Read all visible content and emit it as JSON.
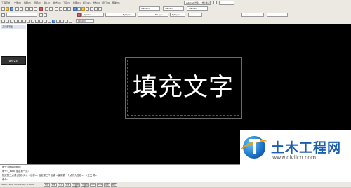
{
  "menu": {
    "title_text": "工程控制",
    "items": [
      "文件(F)",
      "编辑(E)",
      "视图(V)",
      "插入(I)",
      "格式(O)",
      "工具(T)",
      "绘图(D)",
      "标注(N)",
      "修改(M)",
      "窗口(W)",
      "帮助(H)"
    ]
  },
  "toolbar": {
    "workspace": "AutoCAD 经典 - 二维绘图与注释",
    "layer_value": "ByLayer",
    "linetype_value": "ByLayer",
    "lineweight_value": "ByLayer",
    "color_value": "ByColor",
    "scale_value": "1:1",
    "textstyle_value": "Standard",
    "dimstyle_value": "Standard",
    "tablestyle_value": "Standard",
    "zoom_value": "100/200"
  },
  "left_panel": {
    "title": "工具选项板",
    "selected_item": "填充文字"
  },
  "drawing": {
    "text": "填充文字"
  },
  "command": {
    "lines": [
      "命令: 指定对角点:",
      "命令: _solid 指定第一点:",
      "指定第二点或 [位移(D)] <位移>:  指定第二个点或 <使用第一个点作为位移>:  <正交 关>",
      "命令:"
    ]
  },
  "status": {
    "coords": "4280.7968, 2019.1864, 0.0000",
    "buttons": [
      "捕捉",
      "栅格",
      "正交",
      "极轴",
      "对象捕捉",
      "对象追踪",
      "DUCS",
      "DYN",
      "线宽",
      "模型"
    ]
  },
  "watermark": {
    "cn": "土木工程网",
    "url": "www.civilcn.com"
  },
  "colors": {
    "canvas": "#000000",
    "brand_blue": "#1b5fb0",
    "accent_orange": "#e8a020"
  }
}
